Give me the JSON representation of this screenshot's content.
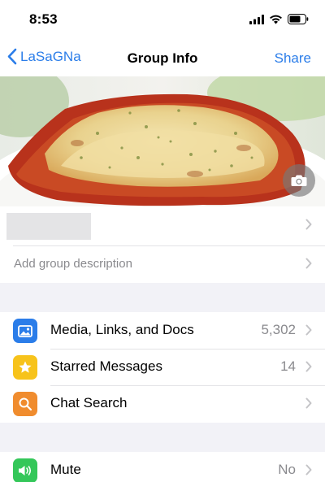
{
  "status_bar": {
    "time": "8:53"
  },
  "nav": {
    "back_label": "LaSaGNa",
    "title": "Group Info",
    "share_label": "Share"
  },
  "group": {
    "description_placeholder": "Add group description"
  },
  "menu_items": [
    {
      "label": "Media, Links, and Docs",
      "value": "5,302",
      "icon": "photo-icon",
      "color": "#2b7de9"
    },
    {
      "label": "Starred Messages",
      "value": "14",
      "icon": "star-icon",
      "color": "#f7c31b"
    },
    {
      "label": "Chat Search",
      "value": "",
      "icon": "search-icon",
      "color": "#f08c2e"
    }
  ],
  "mute": {
    "label": "Mute",
    "value": "No",
    "icon": "speaker-icon",
    "color": "#34c759"
  }
}
